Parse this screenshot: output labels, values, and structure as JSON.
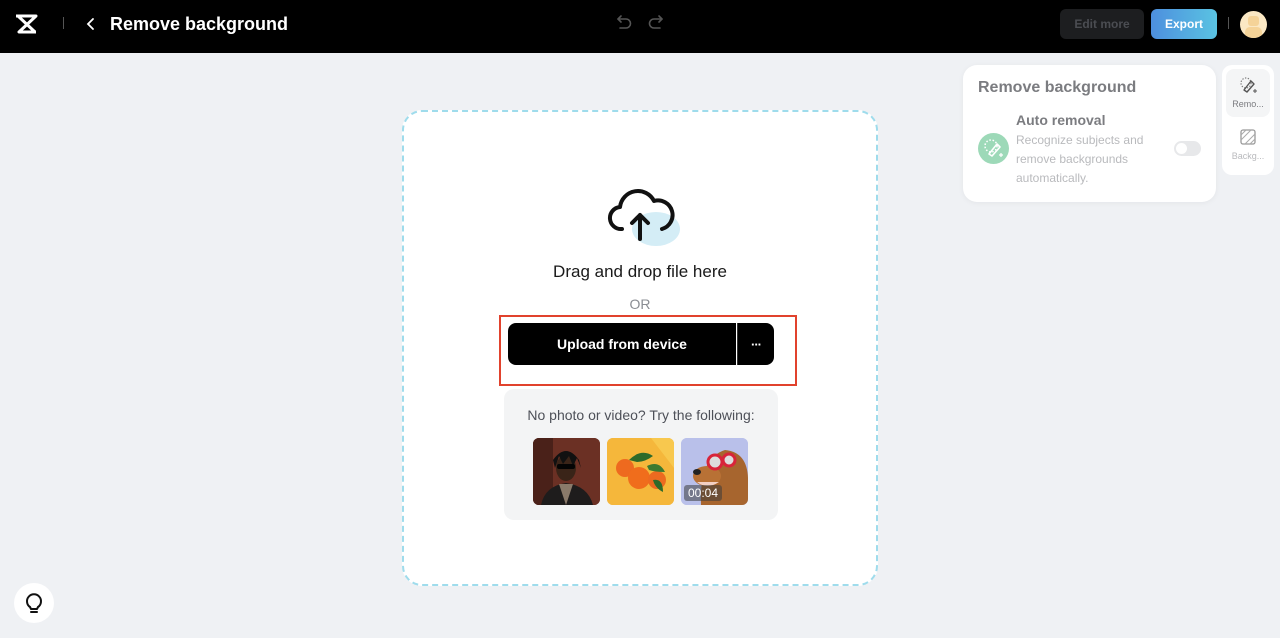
{
  "header": {
    "title": "Remove background",
    "edit_more_label": "Edit more",
    "export_label": "Export",
    "icons": {
      "logo": "capcut-logo",
      "back": "chevron-left-icon",
      "undo": "undo-icon",
      "redo": "redo-icon",
      "avatar": "user-avatar"
    }
  },
  "upload": {
    "drag_text": "Drag and drop file here",
    "or_text": "OR",
    "upload_button_label": "Upload from device",
    "more_button_label": "···",
    "samples_prompt": "No photo or video? Try the following:",
    "samples": [
      {
        "type": "photo",
        "subject": "man with sunglasses"
      },
      {
        "type": "photo",
        "subject": "oranges"
      },
      {
        "type": "video",
        "subject": "dog with goggles",
        "duration": "00:04"
      }
    ]
  },
  "panel": {
    "title": "Remove background",
    "auto_removal": {
      "title": "Auto removal",
      "description": "Recognize subjects and remove backgrounds automatically.",
      "enabled": false
    }
  },
  "side_tabs": [
    {
      "label": "Remo...",
      "icon": "magic-eraser-icon",
      "active": true
    },
    {
      "label": "Backg...",
      "icon": "background-pattern-icon",
      "active": false
    }
  ],
  "colors": {
    "accent_gradient_start": "#4d8fde",
    "accent_gradient_end": "#5ac3e2",
    "dropzone_border": "#9fdcec",
    "highlight": "#e1422d",
    "auto_icon_bg": "#9dd9b8"
  }
}
